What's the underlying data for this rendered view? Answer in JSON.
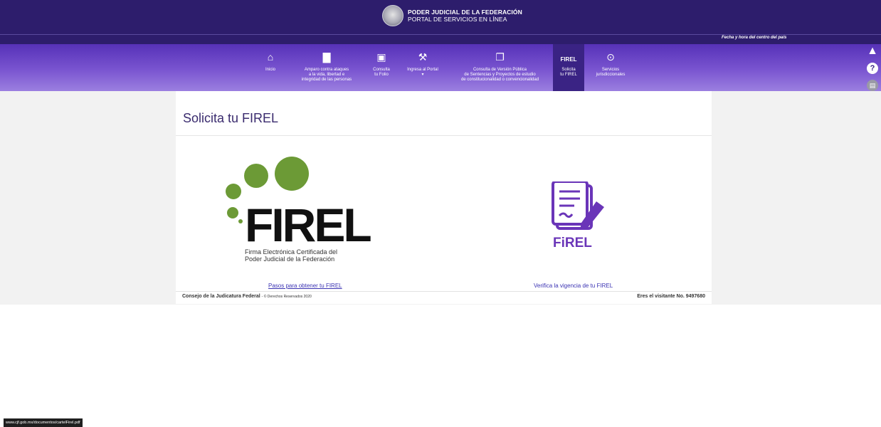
{
  "header": {
    "title": "PODER JUDICIAL DE LA FEDERACIÓN",
    "subtitle": "PORTAL DE SERVICIOS EN LÍNEA",
    "datetime_label": "Fecha y hora del centro del país"
  },
  "nav": {
    "items": [
      {
        "label": "Inicio",
        "icon": "home-icon"
      },
      {
        "label": "Amparo contra ataques\na la vida, libertad e\nintegridad de las personas",
        "icon": "document-icon"
      },
      {
        "label": "Consulta\ntu Folio",
        "icon": "folder-icon"
      },
      {
        "label": "Ingresa al Portal\n▾",
        "icon": "gavel-icon"
      },
      {
        "label": "Consulta de Versión Pública\nde Sentencias y Proyectos de estudio\nde constitucionalidad o convencionalidad",
        "icon": "documents-icon"
      },
      {
        "label": "Solicita\ntu FIREL",
        "icon": "firel-icon",
        "active": true
      },
      {
        "label": "Servicios\njurisdiccionales",
        "icon": "location-icon"
      }
    ]
  },
  "side_icons": [
    "warning-icon",
    "help-icon",
    "chat-icon"
  ],
  "main": {
    "title": "Solicita tu FIREL",
    "logo": {
      "wordmark": "FIREL",
      "caption": "Firma Electrónica Certificada del\nPoder Judicial de la Federación"
    },
    "firel_icon_label": "FiREL",
    "link_pasos": "Pasos para obtener tu FIREL",
    "link_verifica": "Verifica la vigencia de tu FIREL"
  },
  "footer": {
    "left_bold": "Consejo de la Judicatura Federal",
    "left_small": "- © Derechos Reservados 2020",
    "right": "Eres el visitante No. 9497680"
  },
  "status_bar": {
    "url": "www.cjf.gob.mx/documentos/cartelFirel.pdf"
  },
  "colors": {
    "header_bg": "#2d1d6c",
    "nav_gradient_top": "#5631b8",
    "nav_gradient_bottom": "#9b7fe0",
    "firel_green": "#6c9a36",
    "firel_purple": "#6a35b8",
    "link": "#3b33b3"
  }
}
